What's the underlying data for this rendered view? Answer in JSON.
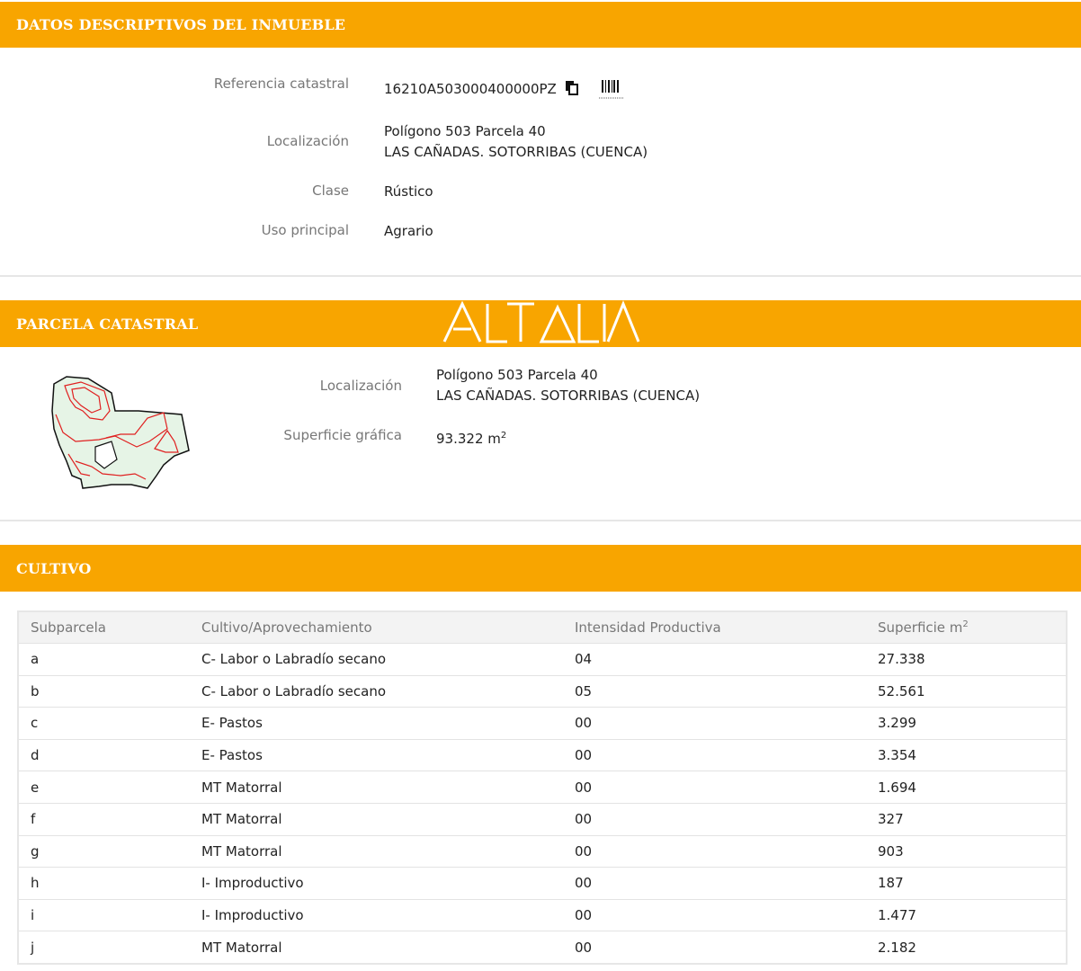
{
  "sections": {
    "datos": {
      "title": "DATOS DESCRIPTIVOS DEL INMUEBLE",
      "labels": {
        "referencia": "Referencia catastral",
        "localizacion": "Localización",
        "clase": "Clase",
        "uso": "Uso principal"
      },
      "values": {
        "referencia": "16210A503000400000PZ",
        "localizacion_line1": "Polígono 503 Parcela 40",
        "localizacion_line2": "LAS CAÑADAS. SOTORRIBAS (CUENCA)",
        "clase": "Rústico",
        "uso": "Agrario"
      }
    },
    "parcela": {
      "title": "PARCELA CATASTRAL",
      "watermark": "ALTALIA",
      "labels": {
        "localizacion": "Localización",
        "superficie": "Superficie gráfica"
      },
      "values": {
        "localizacion_line1": "Polígono 503 Parcela 40",
        "localizacion_line2": "LAS CAÑADAS. SOTORRIBAS (CUENCA)",
        "superficie": "93.322 m",
        "superficie_sup": "2"
      }
    },
    "cultivo": {
      "title": "CULTIVO",
      "headers": {
        "subparcela": "Subparcela",
        "cultivo": "Cultivo/Aprovechamiento",
        "intensidad": "Intensidad Productiva",
        "superficie": "Superficie m",
        "superficie_sup": "2"
      },
      "rows": [
        {
          "sub": "a",
          "cultivo": "C- Labor o Labradío secano",
          "intensidad": "04",
          "superficie": "27.338"
        },
        {
          "sub": "b",
          "cultivo": "C- Labor o Labradío secano",
          "intensidad": "05",
          "superficie": "52.561"
        },
        {
          "sub": "c",
          "cultivo": "E- Pastos",
          "intensidad": "00",
          "superficie": "3.299"
        },
        {
          "sub": "d",
          "cultivo": "E- Pastos",
          "intensidad": "00",
          "superficie": "3.354"
        },
        {
          "sub": "e",
          "cultivo": "MT Matorral",
          "intensidad": "00",
          "superficie": "1.694"
        },
        {
          "sub": "f",
          "cultivo": "MT Matorral",
          "intensidad": "00",
          "superficie": "327"
        },
        {
          "sub": "g",
          "cultivo": "MT Matorral",
          "intensidad": "00",
          "superficie": "903"
        },
        {
          "sub": "h",
          "cultivo": "I- Improductivo",
          "intensidad": "00",
          "superficie": "187"
        },
        {
          "sub": "i",
          "cultivo": "I- Improductivo",
          "intensidad": "00",
          "superficie": "1.477"
        },
        {
          "sub": "j",
          "cultivo": "MT Matorral",
          "intensidad": "00",
          "superficie": "2.182"
        }
      ]
    }
  },
  "icons": {
    "copy": "copy-icon",
    "barcode": "barcode-icon",
    "parcel_map": "parcel-map-thumbnail"
  },
  "colors": {
    "header_bg": "#f8a500",
    "parcel_fill": "#e6f4e6",
    "parcel_lines": "#e02020"
  }
}
